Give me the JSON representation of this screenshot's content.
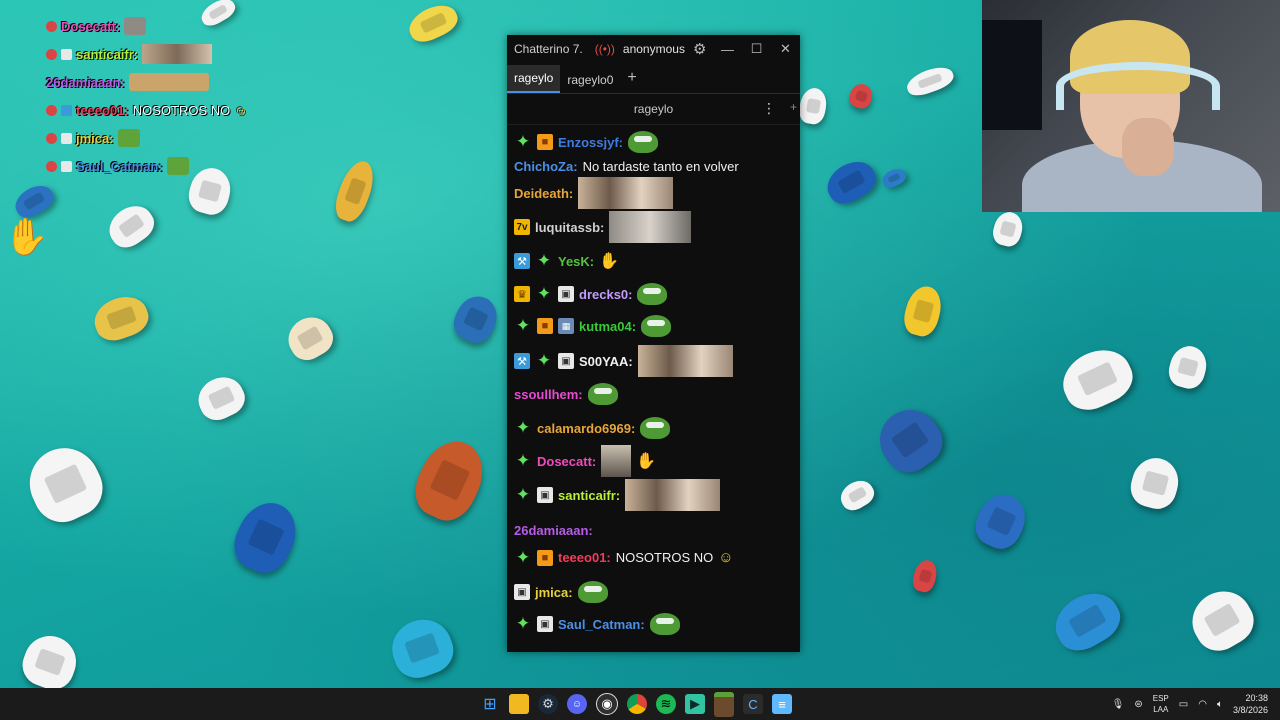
{
  "chatterino": {
    "title": "Chatterino 7.",
    "live_icon": "((•))",
    "account": "anonymous",
    "tabs": [
      "rageylo",
      "rageylo0"
    ],
    "tab_add": "+",
    "split_channel": "rageylo",
    "menu_icon": "⋮",
    "messages": [
      {
        "user": "Enzossjyf:",
        "color": "#3f7ce0",
        "text": ""
      },
      {
        "user": "ChichoZa:",
        "color": "#4b90e6",
        "text": "No tardaste tanto en volver"
      },
      {
        "user": "Deideath:",
        "color": "#e8a637",
        "text": ""
      },
      {
        "user": "luquitassb:",
        "color": "#d0d0d0",
        "text": ""
      },
      {
        "user": "YesK:",
        "color": "#56c13f",
        "text": ""
      },
      {
        "user": "drecks0:",
        "color": "#c39cff",
        "text": ""
      },
      {
        "user": "kutma04:",
        "color": "#39c939",
        "text": ""
      },
      {
        "user": "S00YAA:",
        "color": "#f0f0f0",
        "text": ""
      },
      {
        "user": "ssoullhem:",
        "color": "#e64bd1",
        "text": ""
      },
      {
        "user": "calamardo6969:",
        "color": "#e8a637",
        "text": ""
      },
      {
        "user": "Dosecatt:",
        "color": "#ef4bbd",
        "text": ""
      },
      {
        "user": "santicaifr:",
        "color": "#b9f03a",
        "text": ""
      },
      {
        "user": "26damiaaan:",
        "color": "#b65ce8",
        "text": ""
      },
      {
        "user": "teeeo01:",
        "color": "#ef3d5a",
        "text": "NOSOTROS NO"
      },
      {
        "user": "jmica:",
        "color": "#e8d23b",
        "text": ""
      },
      {
        "user": "Saul_Catman:",
        "color": "#4b90e6",
        "text": ""
      }
    ]
  },
  "overlay_chat": [
    {
      "user": "Dosecatt:",
      "color": "#ef4bbd",
      "text": ""
    },
    {
      "user": "santicaifr:",
      "color": "#b9f03a",
      "text": ""
    },
    {
      "user": "26damiaaan:",
      "color": "#b65ce8",
      "text": ""
    },
    {
      "user": "teeeo01:",
      "color": "#ef3d5a",
      "text": "NOSOTROS NO"
    },
    {
      "user": "jmica:",
      "color": "#e8d23b",
      "text": ""
    },
    {
      "user": "Saul_Catman:",
      "color": "#4b90e6",
      "text": ""
    }
  ],
  "taskbar": {
    "apps": [
      "start-icon",
      "file-explorer-icon",
      "steam-icon",
      "discord-icon",
      "obs-icon",
      "chrome-icon",
      "spotify-icon",
      "streamlabs-icon",
      "minecraft-icon",
      "chatterino-icon",
      "notepad-icon"
    ],
    "lang_top": "ESP",
    "lang_bottom": "LAA",
    "time": "20:38",
    "date": "3/8/2026"
  }
}
